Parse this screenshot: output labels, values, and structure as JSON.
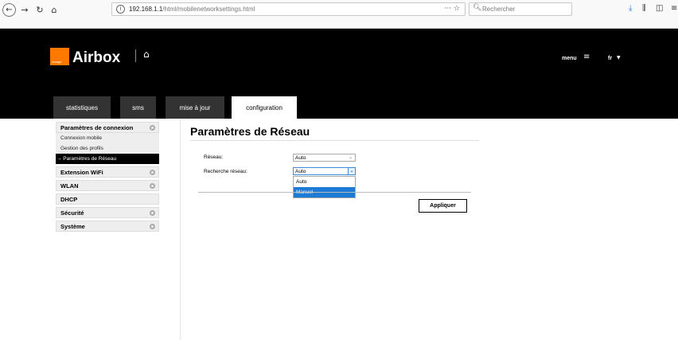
{
  "browser": {
    "url_host": "192.168.1.1",
    "url_path": "/html/mobilenetworksettings.html",
    "url_actions": "··· ☆",
    "search_placeholder": "Rechercher"
  },
  "header": {
    "logo_text": "orange",
    "brand": "Airbox",
    "menu_label": "menu",
    "lang_label": "fr",
    "tabs": [
      {
        "label": "statistiques"
      },
      {
        "label": "sms"
      },
      {
        "label": "mise à jour"
      },
      {
        "label": "configuration"
      }
    ]
  },
  "sidebar": {
    "connection": {
      "title": "Paramètres de connexion",
      "items": [
        {
          "label": "Connexion mobile"
        },
        {
          "label": "Gestion des profils"
        },
        {
          "label": "→ Paramètres de Réseau"
        }
      ]
    },
    "sections": [
      {
        "label": "Extension WiFi"
      },
      {
        "label": "WLAN"
      },
      {
        "label": "DHCP"
      },
      {
        "label": "Sécurité"
      },
      {
        "label": "Système"
      }
    ]
  },
  "main": {
    "title": "Paramètres de Réseau",
    "network_label": "Réseau:",
    "network_value": "Auto",
    "search_label": "Recherche réseau:",
    "search_value": "Auto",
    "dropdown_options": [
      "Auto",
      "Manuel"
    ],
    "apply_label": "Appliquer"
  }
}
